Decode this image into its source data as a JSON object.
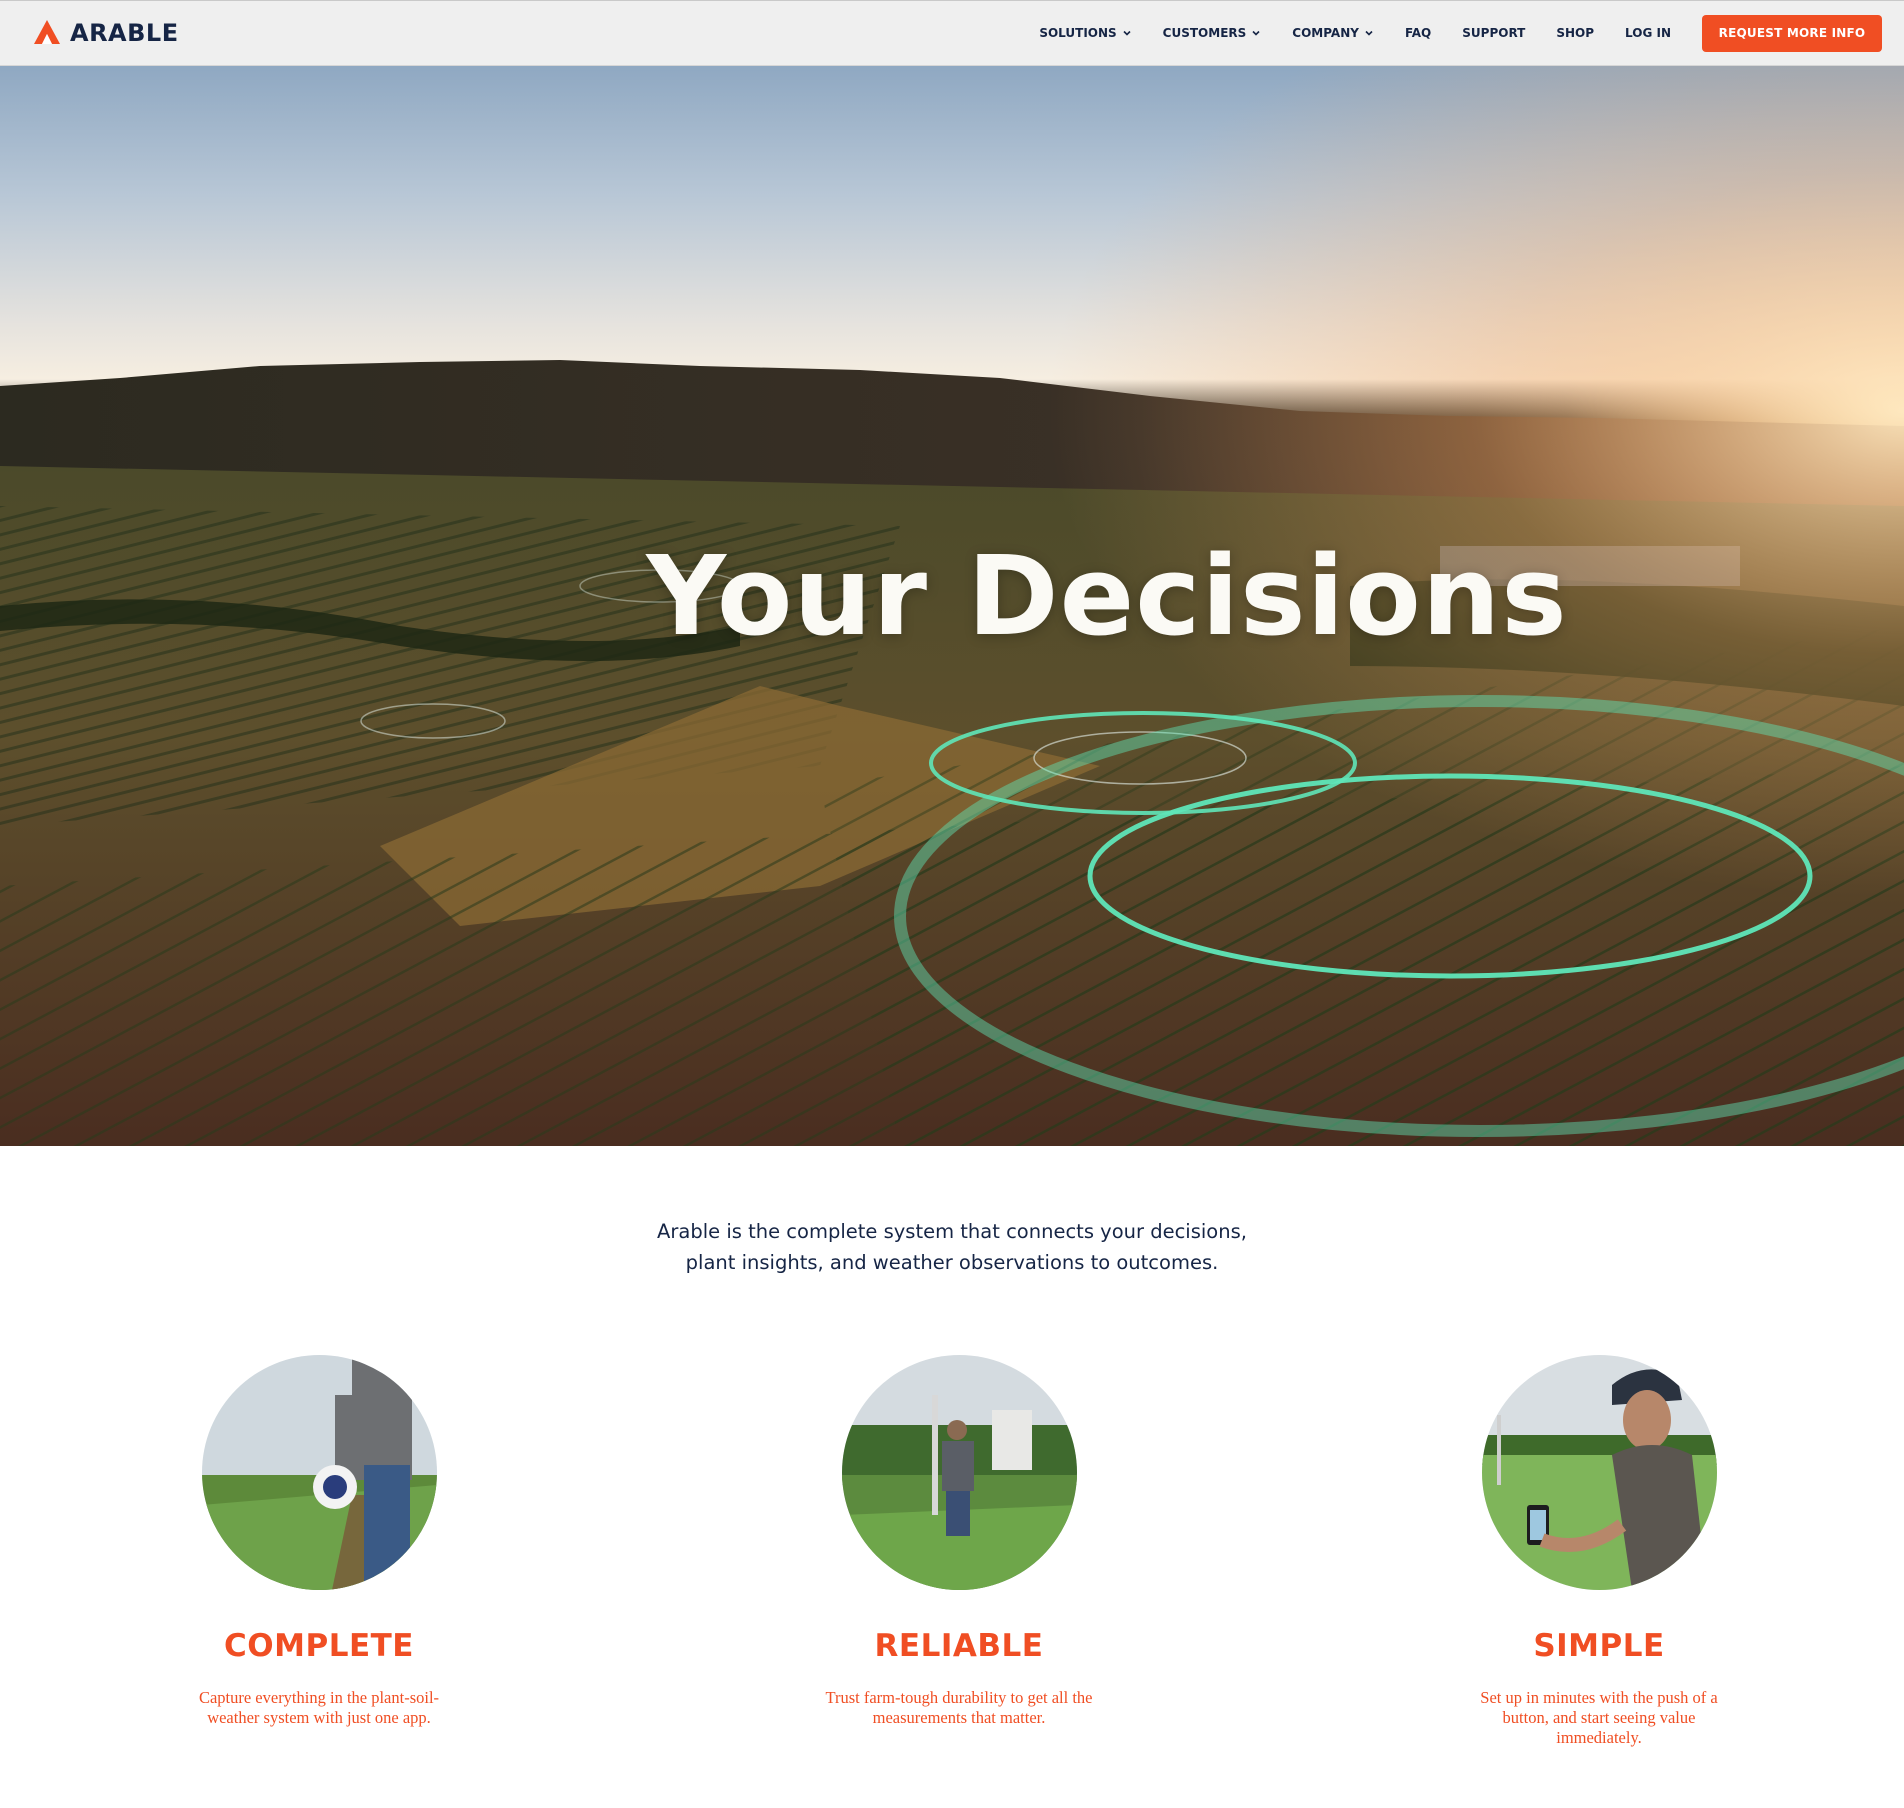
{
  "header": {
    "logo_text": "ARABLE",
    "nav": [
      {
        "label": "SOLUTIONS",
        "has_dropdown": true
      },
      {
        "label": "CUSTOMERS",
        "has_dropdown": true
      },
      {
        "label": "COMPANY",
        "has_dropdown": true
      },
      {
        "label": "FAQ",
        "has_dropdown": false
      },
      {
        "label": "SUPPORT",
        "has_dropdown": false
      },
      {
        "label": "SHOP",
        "has_dropdown": false
      },
      {
        "label": "LOG IN",
        "has_dropdown": false
      }
    ],
    "cta_label": "REQUEST MORE INFO"
  },
  "hero": {
    "title": "Your Decisions"
  },
  "intro": {
    "text": "Arable is the complete system that connects your decisions, plant insights, and weather observations to outcomes."
  },
  "features": [
    {
      "title": "COMPLETE",
      "description": "Capture everything in the plant-soil-weather system with just one app."
    },
    {
      "title": "RELIABLE",
      "description": "Trust farm-tough durability to get all the measurements that matter."
    },
    {
      "title": "SIMPLE",
      "description": "Set up in minutes with the push of a button, and start seeing value immediately."
    }
  ],
  "colors": {
    "brand_orange": "#f04e23",
    "navy": "#162545",
    "header_bg": "#efefef",
    "ring_teal": "#4fe0b0"
  },
  "icons": {
    "logo": "arable-logo-icon",
    "dropdown": "chevron-down-icon"
  }
}
